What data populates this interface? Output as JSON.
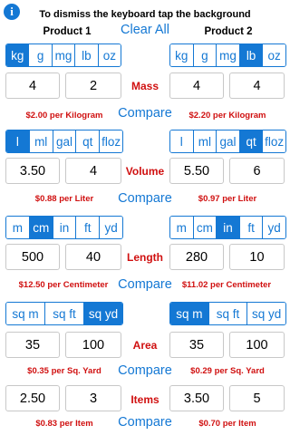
{
  "header": {
    "info_glyph": "i",
    "hint": "To dismiss the keyboard tap the background",
    "product1_label": "Product 1",
    "product2_label": "Product 2",
    "clear_all": "Clear All"
  },
  "mass": {
    "category": "Mass",
    "units": [
      "kg",
      "g",
      "mg",
      "lb",
      "oz"
    ],
    "p1_selected_unit": "kg",
    "p2_selected_unit": "lb",
    "p1_value1": "4",
    "p1_value2": "2",
    "p2_value1": "4",
    "p2_value2": "4",
    "p1_price": "$2.00 per Kilogram",
    "p2_price": "$2.20 per Kilogram",
    "compare": "Compare"
  },
  "volume": {
    "category": "Volume",
    "units": [
      "l",
      "ml",
      "gal",
      "qt",
      "floz"
    ],
    "p1_selected_unit": "l",
    "p2_selected_unit": "qt",
    "p1_value1": "3.50",
    "p1_value2": "4",
    "p2_value1": "5.50",
    "p2_value2": "6",
    "p1_price": "$0.88 per Liter",
    "p2_price": "$0.97 per Liter",
    "compare": "Compare"
  },
  "length": {
    "category": "Length",
    "units": [
      "m",
      "cm",
      "in",
      "ft",
      "yd"
    ],
    "p1_selected_unit": "cm",
    "p2_selected_unit": "in",
    "p1_value1": "500",
    "p1_value2": "40",
    "p2_value1": "280",
    "p2_value2": "10",
    "p1_price": "$12.50 per Centimeter",
    "p2_price": "$11.02 per Centimeter",
    "compare": "Compare"
  },
  "area": {
    "category": "Area",
    "units": [
      "sq m",
      "sq ft",
      "sq yd"
    ],
    "p1_selected_unit": "sq yd",
    "p2_selected_unit": "sq m",
    "p1_value1": "35",
    "p1_value2": "100",
    "p2_value1": "35",
    "p2_value2": "100",
    "p1_price": "$0.35 per Sq. Yard",
    "p2_price": "$0.29 per Sq. Yard",
    "compare": "Compare"
  },
  "items": {
    "category": "Items",
    "p1_value1": "2.50",
    "p1_value2": "3",
    "p2_value1": "3.50",
    "p2_value2": "5",
    "p1_price": "$0.83 per Item",
    "p2_price": "$0.70 per Item",
    "compare": "Compare"
  },
  "colors": {
    "accent": "#1478d4",
    "price_red": "#d01010"
  }
}
